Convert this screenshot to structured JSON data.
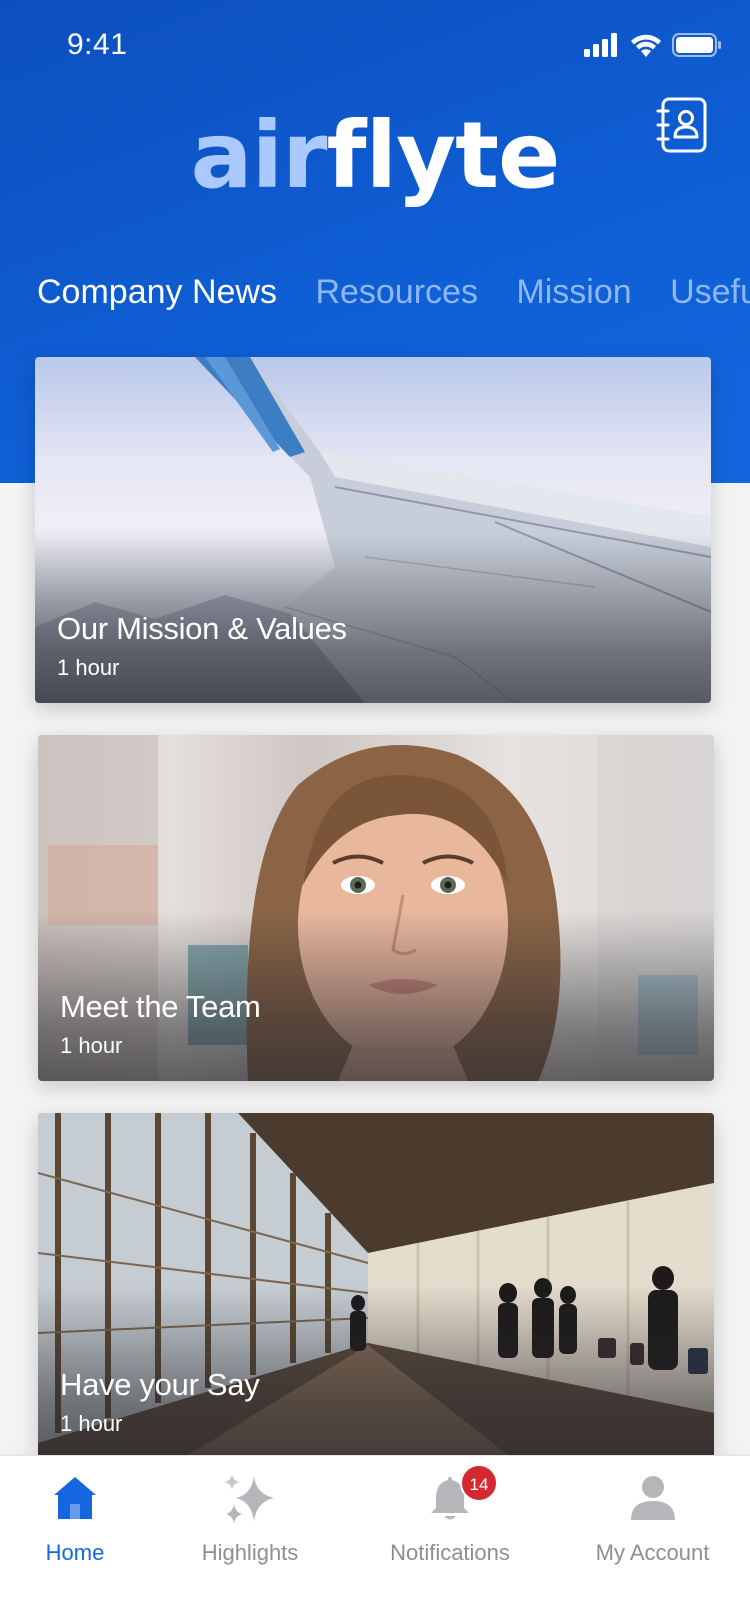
{
  "status_bar": {
    "time": "9:41",
    "signal_icon": "cellular-signal-icon",
    "wifi_icon": "wifi-icon",
    "battery_icon": "battery-icon"
  },
  "header": {
    "logo_part1": "air",
    "logo_part2": "flyte",
    "contacts_icon": "contact-book-icon",
    "brand_color": "#0f5fd6"
  },
  "tabs": [
    {
      "label": "Company News",
      "active": true
    },
    {
      "label": "Resources",
      "active": false
    },
    {
      "label": "Mission",
      "active": false
    },
    {
      "label": "Useful",
      "active": false
    }
  ],
  "cards": [
    {
      "title": "Our Mission & Values",
      "time": "1 hour",
      "image": "airplane-wing-image"
    },
    {
      "title": "Meet the Team",
      "time": "1 hour",
      "image": "woman-portrait-image"
    },
    {
      "title": "Have your Say",
      "time": "1 hour",
      "image": "airport-terminal-image"
    }
  ],
  "bottom_nav": {
    "items": [
      {
        "label": "Home",
        "icon": "home-icon",
        "active": true
      },
      {
        "label": "Highlights",
        "icon": "sparkle-icon",
        "active": false
      },
      {
        "label": "Notifications",
        "icon": "bell-icon",
        "active": false,
        "badge": "14"
      },
      {
        "label": "My Account",
        "icon": "user-icon",
        "active": false
      }
    ],
    "active_color": "#1467df",
    "badge_color": "#d42a2f"
  }
}
